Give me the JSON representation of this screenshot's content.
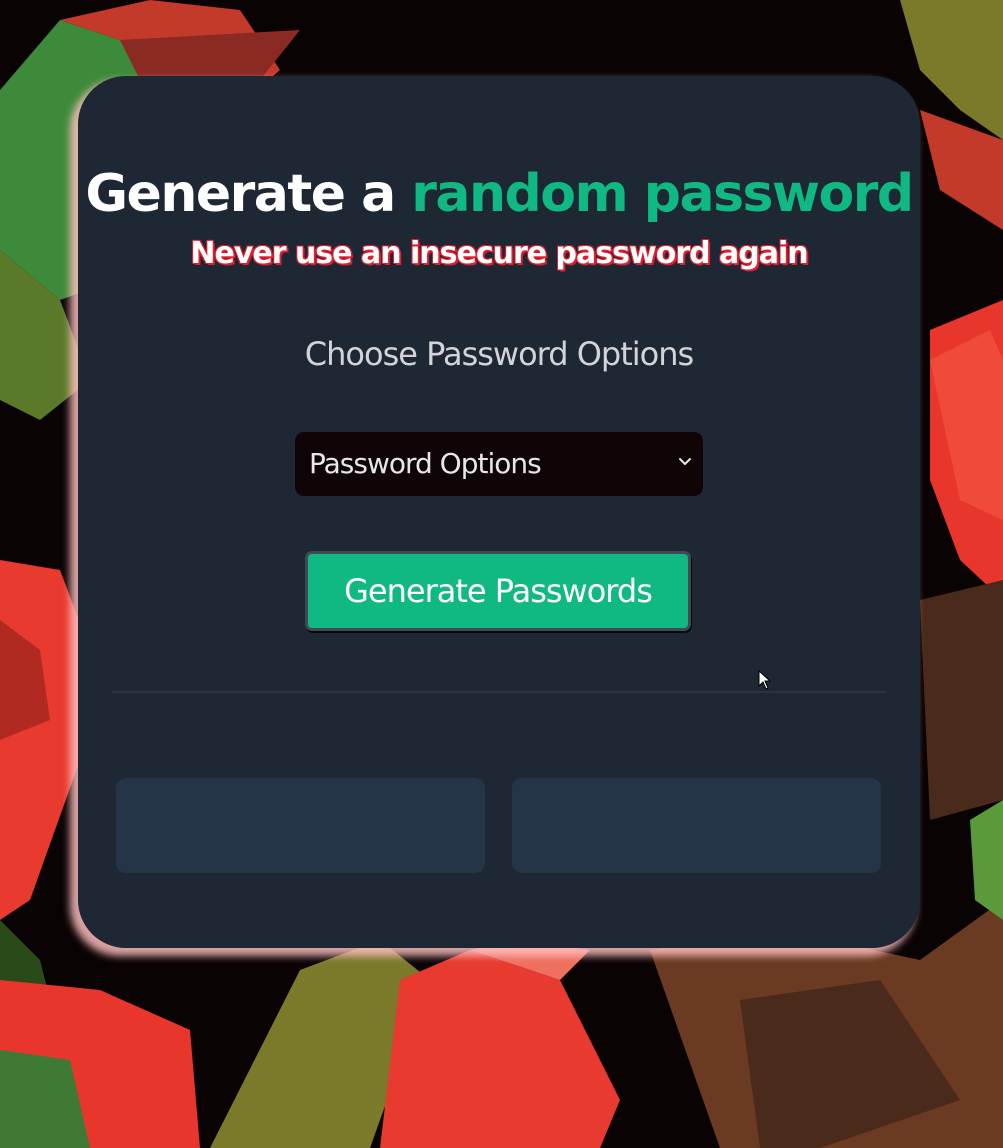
{
  "header": {
    "title_main": "Generate a ",
    "title_accent": "random password",
    "subtitle": "Never use an insecure password again"
  },
  "options": {
    "label": "Choose Password Options",
    "select_value": "Password Options"
  },
  "actions": {
    "generate_label": "Generate Passwords"
  },
  "outputs": [
    {
      "value": ""
    },
    {
      "value": ""
    }
  ],
  "colors": {
    "accent": "#10b981",
    "card": "#1e2835",
    "output_box": "#253447",
    "subtitle_outline": "#e11d2e"
  },
  "icons": {
    "select": "chevron-down-icon",
    "pointer": "cursor-icon"
  }
}
